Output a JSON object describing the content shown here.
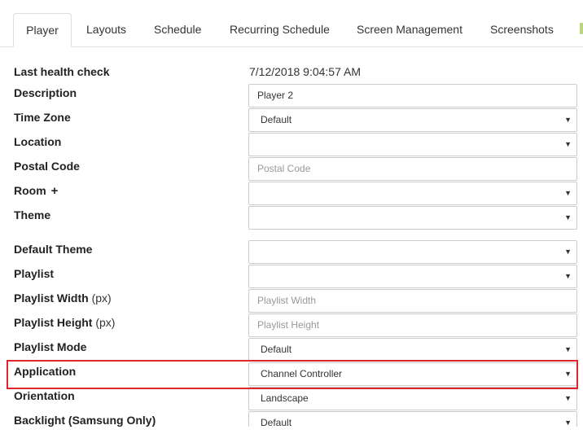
{
  "tabs": [
    {
      "label": "Player",
      "active": true
    },
    {
      "label": "Layouts"
    },
    {
      "label": "Schedule"
    },
    {
      "label": "Recurring Schedule"
    },
    {
      "label": "Screen Management"
    },
    {
      "label": "Screenshots"
    }
  ],
  "form": {
    "last_health_check": {
      "label": "Last health check",
      "value": "7/12/2018 9:04:57 AM"
    },
    "description": {
      "label": "Description",
      "value": "Player 2"
    },
    "time_zone": {
      "label": "Time Zone",
      "value": "Default"
    },
    "location": {
      "label": "Location",
      "value": ""
    },
    "postal_code": {
      "label": "Postal Code",
      "placeholder": "Postal Code"
    },
    "room": {
      "label": "Room",
      "value": ""
    },
    "theme": {
      "label": "Theme",
      "value": ""
    },
    "default_theme": {
      "label": "Default Theme",
      "value": ""
    },
    "playlist": {
      "label": "Playlist",
      "value": ""
    },
    "playlist_width": {
      "label": "Playlist Width",
      "unit": "(px)",
      "placeholder": "Playlist Width"
    },
    "playlist_height": {
      "label": "Playlist Height",
      "unit": "(px)",
      "placeholder": "Playlist Height"
    },
    "playlist_mode": {
      "label": "Playlist Mode",
      "value": "Default"
    },
    "application": {
      "label": "Application",
      "value": "Channel Controller"
    },
    "orientation": {
      "label": "Orientation",
      "value": "Landscape"
    },
    "backlight": {
      "label": "Backlight (Samsung Only)",
      "value": "Default"
    }
  },
  "icons": {
    "plus": "+",
    "caret": "▼"
  },
  "colors": {
    "highlight": "#e0242d",
    "border": "#cccccc"
  }
}
